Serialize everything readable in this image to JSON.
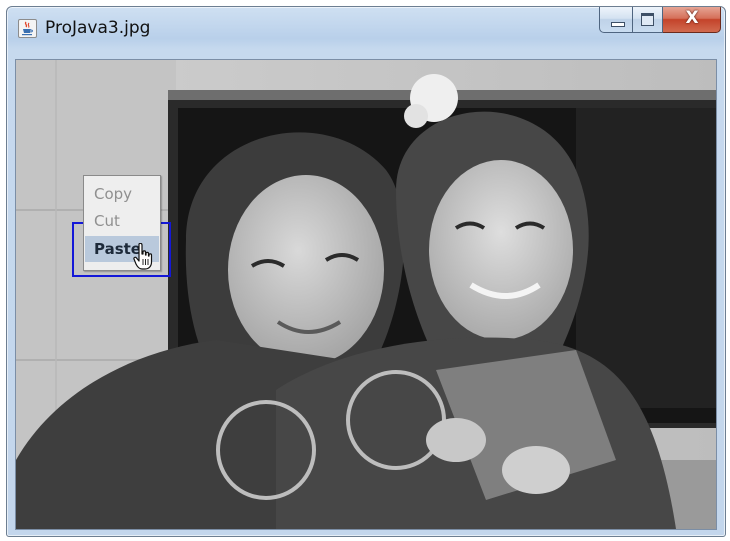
{
  "window": {
    "title": "ProJava3.jpg",
    "close_symbol": "X"
  },
  "context_menu": {
    "items": [
      {
        "label": "Copy",
        "state": "disabled"
      },
      {
        "label": "Cut",
        "state": "disabled"
      },
      {
        "label": "Paste",
        "state": "highlighted"
      }
    ]
  },
  "icons": {
    "app": "java-coffee-cup-icon",
    "minimize": "minimize-icon",
    "maximize": "maximize-icon",
    "close": "close-icon",
    "cursor": "hand-pointer-cursor-icon"
  },
  "colors": {
    "title_bar": "#c3d6ec",
    "close_button": "#c4432a",
    "menu_highlight": "#b9c9dc",
    "focus_border": "#1418d8"
  }
}
